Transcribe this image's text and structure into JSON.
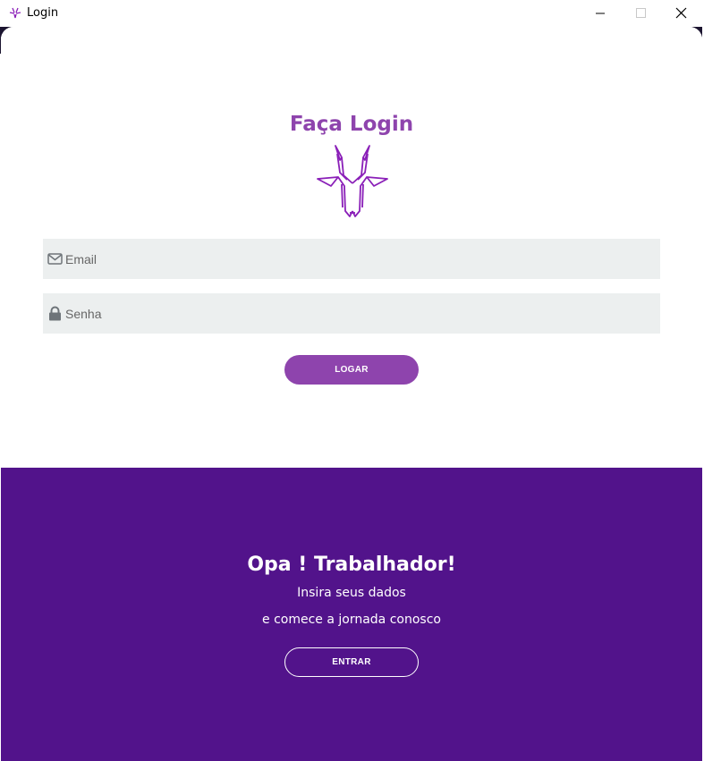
{
  "window": {
    "title": "Login",
    "controls": [
      "minimize",
      "maximize",
      "close"
    ]
  },
  "login": {
    "title": "Faça Login",
    "logo_icon": "antelope-head-logo-icon",
    "email": {
      "placeholder": "Email",
      "value": "",
      "icon": "envelope-icon"
    },
    "password": {
      "placeholder": "Senha",
      "value": "",
      "icon": "lock-icon"
    },
    "submit_label": "LOGAR"
  },
  "welcome": {
    "title": "Opa ! Trabalhador!",
    "line1": "Insira seus dados",
    "line2": "e comece a jornada conosco",
    "button_label": "ENTRAR"
  },
  "colors": {
    "accent": "#8e44ad",
    "panel": "#52138b",
    "field_bg": "#ecefef"
  }
}
